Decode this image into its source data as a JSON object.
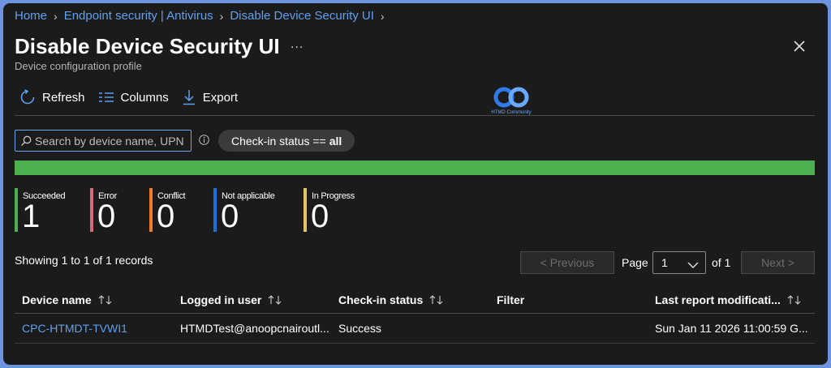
{
  "breadcrumb": [
    {
      "label": "Home"
    },
    {
      "label": "Endpoint security | Antivirus"
    },
    {
      "label": "Disable Device Security UI"
    }
  ],
  "header": {
    "title": "Disable Device Security UI",
    "more": "...",
    "subtitle": "Device configuration profile"
  },
  "toolbar": {
    "refresh": "Refresh",
    "columns": "Columns",
    "export": "Export"
  },
  "logo": {
    "text": "HTMD Community"
  },
  "search": {
    "placeholder": "Search by device name, UPN"
  },
  "filter": {
    "prefix": "Check-in status ==",
    "value": "all"
  },
  "progress": {
    "succeeded_fraction": 1.0,
    "color": "#4caf50"
  },
  "stats": [
    {
      "label": "Succeeded",
      "value": "1",
      "color": "#4caf50"
    },
    {
      "label": "Error",
      "value": "0",
      "color": "#d16b7a"
    },
    {
      "label": "Conflict",
      "value": "0",
      "color": "#f07a2a"
    },
    {
      "label": "Not applicable",
      "value": "0",
      "color": "#1d6fe0"
    },
    {
      "label": "In Progress",
      "value": "0",
      "color": "#e2c46a"
    }
  ],
  "pagination": {
    "showing": "Showing 1 to 1 of 1 records",
    "previous": "< Previous",
    "page_label": "Page",
    "page_value": "1",
    "of_label": "of 1",
    "next": "Next >"
  },
  "table": {
    "columns": [
      "Device name",
      "Logged in user",
      "Check-in status",
      "Filter",
      "Last report modificati..."
    ],
    "rows": [
      {
        "device": "CPC-HTMDT-TVWI1",
        "user": "HTMDTest@anoopcnairoutl...",
        "status": "Success",
        "filter": "",
        "last_report": "Sun Jan 11 2026 11:00:59 G..."
      }
    ]
  }
}
